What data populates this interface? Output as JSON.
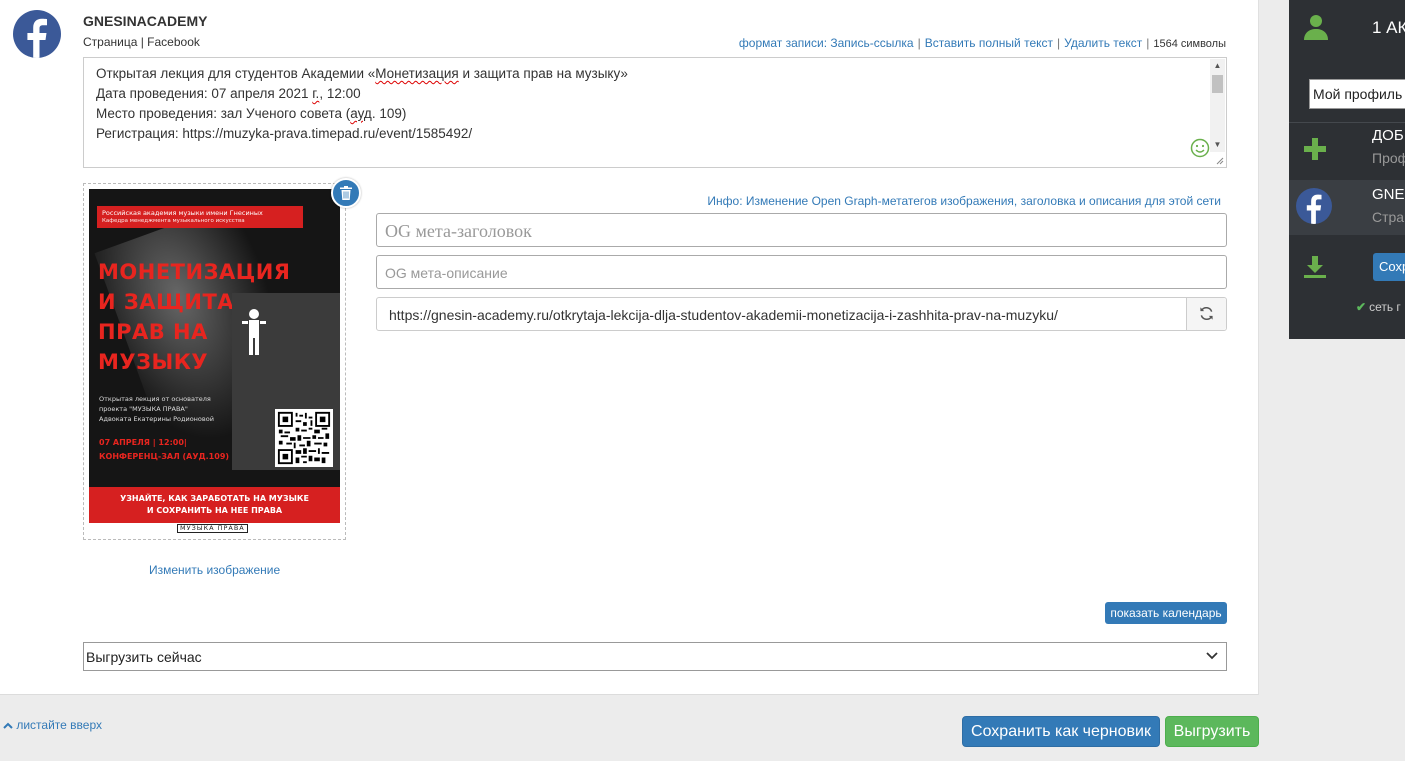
{
  "account": {
    "name": "GNESINACADEMY",
    "subtitle": "Страница | Facebook"
  },
  "actions": {
    "format": "формат записи: Запись-ссылка",
    "insert_full": "Вставить полный текст",
    "delete_text": "Удалить текст",
    "separator": "|",
    "char_count": "1564 символы"
  },
  "post_text": {
    "line1_a": "Открытая лекция для студентов Академии «",
    "line1_b": "Монетизация",
    "line1_c": " и защита прав на музыку»",
    "line2_a": "Дата проведения: 07 апреля 2021 ",
    "line2_b": "г.",
    "line2_c": ", 12:00",
    "line3_a": "Место проведения: зал Ученого совета (",
    "line3_b": "ауд",
    "line3_c": ". 109)",
    "line4": "Регистрация: https://muzyka-prava.timepad.ru/event/1585492/"
  },
  "poster": {
    "header": "Российская академия музыки имени Гнесиных",
    "header_sub": "Кафедра менеджмента музыкального искусства",
    "title_lines": [
      "МОНЕТИЗАЦИЯ",
      "И ЗАЩИТА",
      "ПРАВ НА",
      "МУЗЫКУ"
    ],
    "desc_lines": [
      "Открытая лекция от основателя",
      "проекта \"МУЗЫКА ПРАВА\"",
      "Адвоката Екатерины Родионовой"
    ],
    "date": "07 АПРЕЛЯ | 12:00|",
    "place": "КОНФЕРЕНЦ-ЗАЛ (АУД.109)",
    "band_lines": [
      "УЗНАЙТЕ, КАК ЗАРАБОТАТЬ НА МУЗЫКЕ",
      "И СОХРАНИТЬ НА НЕЕ ПРАВА"
    ],
    "footer": "МУЗЫКА ПРАВА"
  },
  "image": {
    "change_label": "Изменить изображение"
  },
  "og": {
    "info": "Инфо: Изменение Open Graph-метатегов изображения, заголовка и описания для этой сети",
    "title_placeholder": "OG мета-заголовок",
    "desc_placeholder": "OG мета-описание",
    "url": "https://gnesin-academy.ru/otkrytaja-lekcija-dlja-studentov-akademii-monetizacija-i-zashhita-prav-na-muzyku/"
  },
  "schedule": {
    "calendar_button": "показать календарь",
    "select_value": "Выгрузить сейчас"
  },
  "footer": {
    "scroll_up": "листайте вверх",
    "save_draft": "Сохранить как черновик",
    "publish": "Выгрузить"
  },
  "sidebar": {
    "account_count": "1 АК",
    "profile_select": "Мой профиль",
    "add_label": "ДОБ",
    "add_sub": "Проф",
    "item_name": "GNE",
    "item_sub": "Стра",
    "save_button": "Сохр",
    "network_status": "сеть г"
  },
  "colors": {
    "link": "#337ab7",
    "primary": "#337ab7",
    "success": "#5cb85c",
    "facebook": "#3b5998",
    "sidebar_bg": "#2d3034",
    "poster_red": "#d62020"
  }
}
